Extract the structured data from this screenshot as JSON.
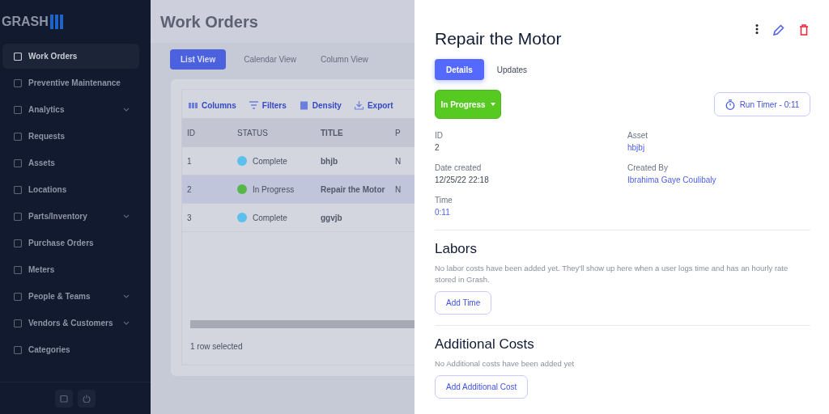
{
  "sidebar": {
    "logo": "GRASH",
    "items": [
      {
        "label": "Work Orders",
        "selected": true,
        "has_submenu": false
      },
      {
        "label": "Preventive Maintenance",
        "selected": false,
        "has_submenu": false
      },
      {
        "label": "Analytics",
        "selected": false,
        "has_submenu": true
      },
      {
        "label": "Requests",
        "selected": false,
        "has_submenu": false
      },
      {
        "label": "Assets",
        "selected": false,
        "has_submenu": false
      },
      {
        "label": "Locations",
        "selected": false,
        "has_submenu": false
      },
      {
        "label": "Parts/Inventory",
        "selected": false,
        "has_submenu": true
      },
      {
        "label": "Purchase Orders",
        "selected": false,
        "has_submenu": false
      },
      {
        "label": "Meters",
        "selected": false,
        "has_submenu": false
      },
      {
        "label": "People & Teams",
        "selected": false,
        "has_submenu": true
      },
      {
        "label": "Vendors & Customers",
        "selected": false,
        "has_submenu": true
      },
      {
        "label": "Categories",
        "selected": false,
        "has_submenu": false
      }
    ]
  },
  "page": {
    "title": "Work Orders",
    "view_tabs": [
      {
        "label": "List View",
        "selected": true
      },
      {
        "label": "Calendar View",
        "selected": false
      },
      {
        "label": "Column View",
        "selected": false
      }
    ],
    "toolbar": [
      "Columns",
      "Filters",
      "Density",
      "Export"
    ],
    "table": {
      "columns": [
        "ID",
        "STATUS",
        "TITLE",
        "P"
      ],
      "rows": [
        {
          "id": "1",
          "status": "Complete",
          "color": "#5bc0eb",
          "title": "bhjb",
          "column_4": "N",
          "selected": false
        },
        {
          "id": "2",
          "status": "In Progress",
          "color": "#57b84a",
          "title": "Repair the Motor",
          "column_4": "N",
          "selected": true
        },
        {
          "id": "3",
          "status": "Complete",
          "color": "#5bc0eb",
          "title": "ggvjb",
          "column_4": "",
          "selected": false
        }
      ]
    },
    "footer": "1 row selected"
  },
  "drawer": {
    "title": "Repair the Motor",
    "tabs": [
      {
        "label": "Details",
        "selected": true
      },
      {
        "label": "Updates",
        "selected": false
      }
    ],
    "status": "In Progress",
    "timer_button": "Run Timer - 0:11",
    "fields": [
      {
        "label": "ID",
        "value": "2",
        "kind": "text"
      },
      {
        "label": "Asset",
        "value": "hbjbj",
        "kind": "link"
      },
      {
        "label": "Date created",
        "value": "12/25/22 22:18",
        "kind": "text"
      },
      {
        "label": "Created By",
        "value": "Ibrahima Gaye Coulibaly",
        "kind": "link"
      },
      {
        "label": "Time",
        "value": "0:11",
        "kind": "link"
      }
    ],
    "sections": [
      {
        "heading": "Labors",
        "text": "No labor costs have been added yet. They'll show up here when a user logs time and has an hourly rate stored in Grash.",
        "button": "Add Time"
      },
      {
        "heading": "Additional Costs",
        "text": "No Additional costs have been added yet",
        "button": "Add Additional Cost"
      }
    ]
  }
}
